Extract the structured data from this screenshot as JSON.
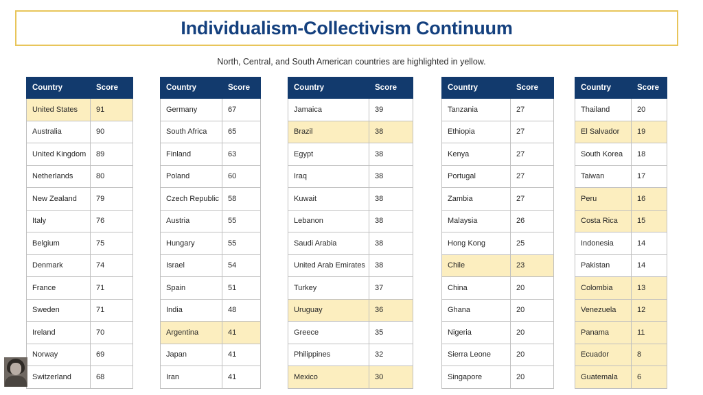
{
  "title": "Individualism-Collectivism Continuum",
  "subtitle": "North, Central, and South American countries are highlighted in yellow.",
  "colors": {
    "title_text": "#14407e",
    "banner_border": "#e8c55a",
    "header_bg": "#123a6d",
    "header_text": "#ffffff",
    "highlight_bg": "#fceebf",
    "cell_border": "#bfbfbf"
  },
  "columns": {
    "country": "Country",
    "score": "Score"
  },
  "photo": {
    "alt_name": "presenter-photo"
  },
  "chart_data": {
    "type": "table",
    "title": "Individualism-Collectivism Continuum",
    "subtitle": "North, Central, and South American countries are highlighted in yellow.",
    "columns": [
      "Country",
      "Score"
    ],
    "highlight_meaning": "North, Central, and South American countries",
    "tables": [
      {
        "id": "table-1",
        "rows": [
          {
            "country": "United States",
            "score": "91",
            "highlight": true
          },
          {
            "country": "Australia",
            "score": "90",
            "highlight": false
          },
          {
            "country": "United Kingdom",
            "score": "89",
            "highlight": false
          },
          {
            "country": "Netherlands",
            "score": "80",
            "highlight": false
          },
          {
            "country": "New Zealand",
            "score": "79",
            "highlight": false
          },
          {
            "country": "Italy",
            "score": "76",
            "highlight": false
          },
          {
            "country": "Belgium",
            "score": "75",
            "highlight": false
          },
          {
            "country": "Denmark",
            "score": "74",
            "highlight": false
          },
          {
            "country": "France",
            "score": "71",
            "highlight": false
          },
          {
            "country": "Sweden",
            "score": "71",
            "highlight": false
          },
          {
            "country": "Ireland",
            "score": "70",
            "highlight": false
          },
          {
            "country": "Norway",
            "score": "69",
            "highlight": false
          },
          {
            "country": "Switzerland",
            "score": "68",
            "highlight": false
          }
        ]
      },
      {
        "id": "table-2",
        "rows": [
          {
            "country": "Germany",
            "score": "67",
            "highlight": false
          },
          {
            "country": "South Africa",
            "score": "65",
            "highlight": false
          },
          {
            "country": "Finland",
            "score": "63",
            "highlight": false
          },
          {
            "country": "Poland",
            "score": "60",
            "highlight": false
          },
          {
            "country": "Czech Republic",
            "score": "58",
            "highlight": false
          },
          {
            "country": "Austria",
            "score": "55",
            "highlight": false
          },
          {
            "country": "Hungary",
            "score": "55",
            "highlight": false
          },
          {
            "country": "Israel",
            "score": "54",
            "highlight": false
          },
          {
            "country": "Spain",
            "score": "51",
            "highlight": false
          },
          {
            "country": "India",
            "score": "48",
            "highlight": false
          },
          {
            "country": "Argentina",
            "score": "41",
            "highlight": true
          },
          {
            "country": "Japan",
            "score": "41",
            "highlight": false
          },
          {
            "country": "Iran",
            "score": "41",
            "highlight": false
          }
        ]
      },
      {
        "id": "table-3",
        "rows": [
          {
            "country": "Jamaica",
            "score": "39",
            "highlight": false
          },
          {
            "country": "Brazil",
            "score": "38",
            "highlight": true
          },
          {
            "country": "Egypt",
            "score": "38",
            "highlight": false
          },
          {
            "country": "Iraq",
            "score": "38",
            "highlight": false
          },
          {
            "country": "Kuwait",
            "score": "38",
            "highlight": false
          },
          {
            "country": "Lebanon",
            "score": "38",
            "highlight": false
          },
          {
            "country": "Saudi Arabia",
            "score": "38",
            "highlight": false
          },
          {
            "country": "United Arab Emirates",
            "score": "38",
            "highlight": false
          },
          {
            "country": "Turkey",
            "score": "37",
            "highlight": false
          },
          {
            "country": "Uruguay",
            "score": "36",
            "highlight": true
          },
          {
            "country": "Greece",
            "score": "35",
            "highlight": false
          },
          {
            "country": "Philippines",
            "score": "32",
            "highlight": false
          },
          {
            "country": "Mexico",
            "score": "30",
            "highlight": true
          }
        ]
      },
      {
        "id": "table-4",
        "rows": [
          {
            "country": "Tanzania",
            "score": "27",
            "highlight": false
          },
          {
            "country": "Ethiopia",
            "score": "27",
            "highlight": false
          },
          {
            "country": "Kenya",
            "score": "27",
            "highlight": false
          },
          {
            "country": "Portugal",
            "score": "27",
            "highlight": false
          },
          {
            "country": "Zambia",
            "score": "27",
            "highlight": false
          },
          {
            "country": "Malaysia",
            "score": "26",
            "highlight": false
          },
          {
            "country": "Hong Kong",
            "score": "25",
            "highlight": false
          },
          {
            "country": "Chile",
            "score": "23",
            "highlight": true
          },
          {
            "country": "China",
            "score": "20",
            "highlight": false
          },
          {
            "country": "Ghana",
            "score": "20",
            "highlight": false
          },
          {
            "country": "Nigeria",
            "score": "20",
            "highlight": false
          },
          {
            "country": "Sierra Leone",
            "score": "20",
            "highlight": false
          },
          {
            "country": "Singapore",
            "score": "20",
            "highlight": false
          }
        ]
      },
      {
        "id": "table-5",
        "rows": [
          {
            "country": "Thailand",
            "score": "20",
            "highlight": false
          },
          {
            "country": "El Salvador",
            "score": "19",
            "highlight": true
          },
          {
            "country": "South Korea",
            "score": "18",
            "highlight": false
          },
          {
            "country": "Taiwan",
            "score": "17",
            "highlight": false
          },
          {
            "country": "Peru",
            "score": "16",
            "highlight": true
          },
          {
            "country": "Costa Rica",
            "score": "15",
            "highlight": true
          },
          {
            "country": "Indonesia",
            "score": "14",
            "highlight": false
          },
          {
            "country": "Pakistan",
            "score": "14",
            "highlight": false
          },
          {
            "country": "Colombia",
            "score": "13",
            "highlight": true
          },
          {
            "country": "Venezuela",
            "score": "12",
            "highlight": true
          },
          {
            "country": "Panama",
            "score": "11",
            "highlight": true
          },
          {
            "country": "Ecuador",
            "score": "8",
            "highlight": true
          },
          {
            "country": "Guatemala",
            "score": "6",
            "highlight": true
          }
        ]
      }
    ]
  }
}
